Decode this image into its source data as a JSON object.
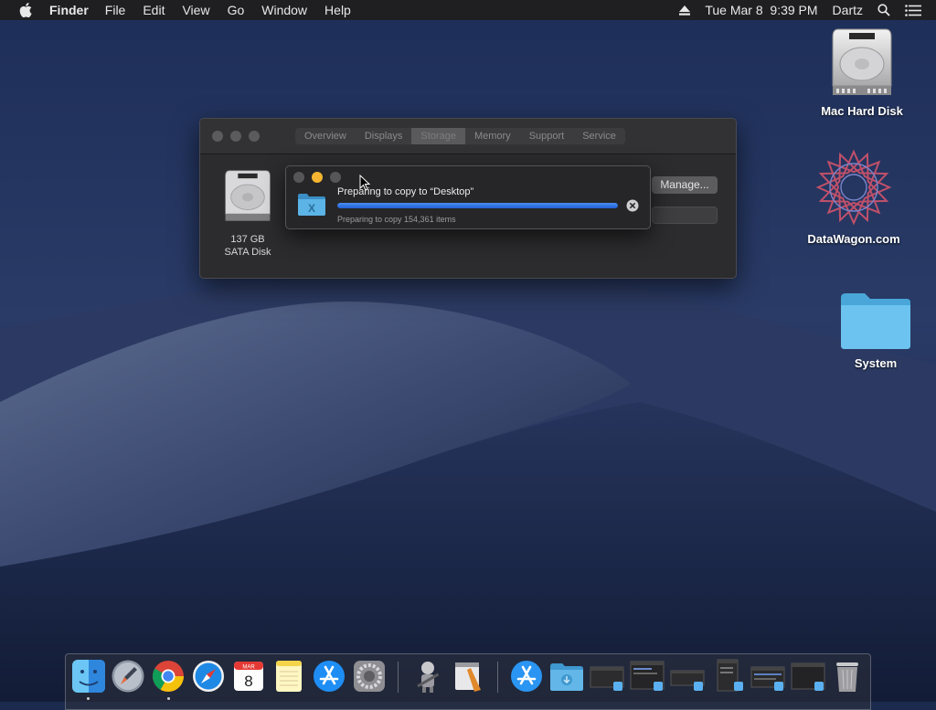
{
  "menubar": {
    "app": "Finder",
    "items": [
      "File",
      "Edit",
      "View",
      "Go",
      "Window",
      "Help"
    ],
    "datetime": "Tue Mar 8  9:39 PM",
    "user": "Dartz",
    "icons": [
      "apple-icon",
      "eject-icon",
      "spotlight-search-icon",
      "notification-center-icon"
    ]
  },
  "desktop": {
    "icons": [
      {
        "label": "Mac Hard Disk",
        "icon": "hard-disk-icon"
      },
      {
        "label": "DataWagon.com",
        "icon": "datawagon-logo-icon"
      },
      {
        "label": "System",
        "icon": "folder-icon"
      }
    ]
  },
  "about_window": {
    "tabs": [
      "Overview",
      "Displays",
      "Storage",
      "Memory",
      "Support",
      "Service"
    ],
    "active_tab": "Storage",
    "disk_size": "137 GB",
    "disk_type": "SATA Disk",
    "manage_label": "Manage..."
  },
  "copy_dialog": {
    "title": "Preparing to copy to “Desktop”",
    "subtitle": "Preparing to copy 154,361 items",
    "progress": 1.0
  },
  "dock": {
    "apps": [
      "finder-icon",
      "launchpad-icon",
      "chrome-icon",
      "safari-icon",
      "calendar-icon",
      "notes-icon",
      "app-store-icon",
      "system-preferences-icon",
      "automator-icon",
      "script-editor-icon",
      "app-store-folder-icon",
      "downloads-folder-icon",
      "window-thumbnail-icon",
      "trash-icon"
    ],
    "calendar_month": "MAR",
    "calendar_day": "8"
  },
  "colors": {
    "accent": "#2f6fe4",
    "traffic_yellow": "#f5b530"
  }
}
